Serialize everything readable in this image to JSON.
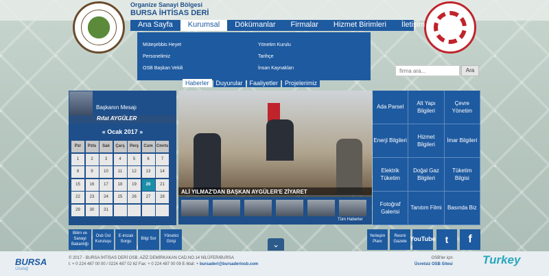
{
  "header": {
    "sub_title": "Organize Sanayi Bölgesi",
    "main_title": "BURSA İHTİSAS DERİ",
    "logo_left_year": "1994"
  },
  "nav": {
    "items": [
      "Ana Sayfa",
      "Kurumsal",
      "Dökümanlar",
      "Firmalar",
      "Hizmet Birimleri",
      "İletişim"
    ],
    "active": "Kurumsal"
  },
  "dropdown": {
    "col1": [
      "Müteşebbis Heyet",
      "Personelimiz",
      "OSB Başkan Vekili"
    ],
    "col2": [
      "Yönetim Kurulu",
      "Tarihçe",
      "İnsan Kaynakları"
    ]
  },
  "search": {
    "placeholder": "firma ara...",
    "button": "Ara"
  },
  "tabs": [
    "Haberler",
    "Duyurular",
    "Faaliyetler",
    "Projelerimiz"
  ],
  "mayor": {
    "title": "Başkanın Mesajı",
    "name": "Rıfat AYGÜLER"
  },
  "calendar": {
    "title": "« Ocak 2017 »",
    "days": [
      "Pzr",
      "Pzts",
      "Salı",
      "Çarş",
      "Perş",
      "Cum",
      "Cmrts"
    ],
    "cells": [
      "1",
      "2",
      "3",
      "4",
      "5",
      "6",
      "7",
      "8",
      "9",
      "10",
      "11",
      "12",
      "13",
      "14",
      "15",
      "16",
      "17",
      "18",
      "19",
      "20",
      "21",
      "22",
      "23",
      "24",
      "25",
      "26",
      "27",
      "28",
      "29",
      "30",
      "31",
      "",
      "",
      "",
      ""
    ],
    "today": "20"
  },
  "news": {
    "caption": "ALİ YILMAZ'DAN BAŞKAN AYGÜLER'E ZİYARET",
    "all_news": "Tüm Haberler"
  },
  "services": [
    "Ada Parsel",
    "Alt Yapı Bilgileri",
    "Çevre Yönetim",
    "Enerji Bilgileri",
    "Hizmet Bilgileri",
    "İmar Bilgileri",
    "Elektrik Tüketim",
    "Doğal Gaz Bilgileri",
    "Tüketim Bilgisi",
    "Fotoğraf Galerisi",
    "Tanıtım Filmi",
    "Basında Biz"
  ],
  "quick_links": [
    "Bilim ve Sanayi Bakanlığı",
    "Osb Üst Kuruluşu",
    "E-imzalı Sorgu",
    "Bilgi Sor",
    "Yönetici Girişi"
  ],
  "right_links": [
    "Yerleşim Planı",
    "Resmi Gazete",
    "YouTube",
    "t",
    "f"
  ],
  "footer": {
    "logo": "BURSA",
    "logo_sub": "Uludağ",
    "line1": "© 2017 - BURSA İHTİSAS DERİ OSB. AZİZ DEMİRKAKAN CAD.NO.14 NİLÜFER/BURSA",
    "line2_prefix": "t: + 0 224 487 00 00 / 0224 487 02 62 Fax: + 0 224 487 00 09 E-Mail: +",
    "email": "bursaderi@bursaderiosb.com",
    "osb_line1": "OSB'ler için",
    "osb_line2": "Ücretsiz OSB Sitesi",
    "turkey": "Turkey"
  }
}
